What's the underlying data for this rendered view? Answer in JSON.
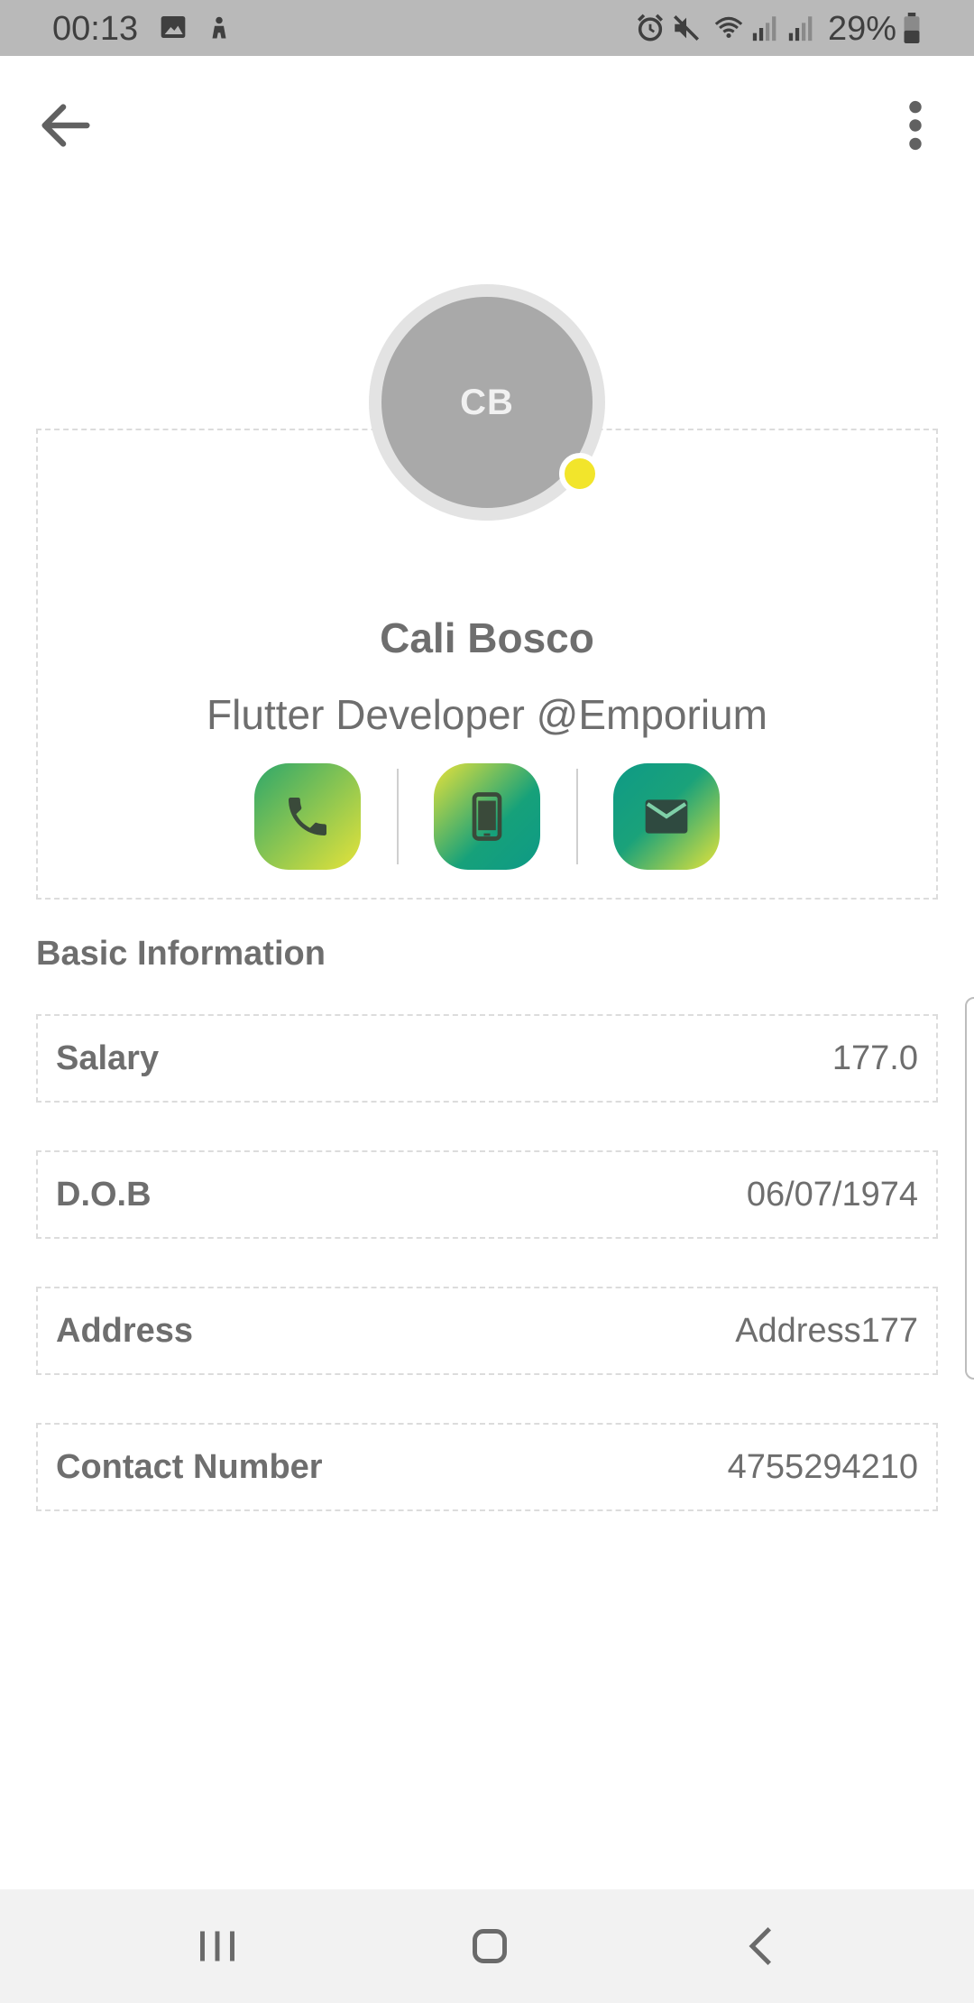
{
  "status_bar": {
    "time": "00:13",
    "battery": "29%",
    "icons": [
      "image-icon",
      "android-debug-icon",
      "alarm-icon",
      "mute-icon",
      "wifi-icon",
      "signal-icon",
      "signal-icon",
      "battery-icon"
    ]
  },
  "app_bar": {
    "back_icon": "arrow-left-icon",
    "menu_icon": "more-vertical-icon"
  },
  "profile": {
    "initials": "CB",
    "name": "Cali Bosco",
    "subtitle": "Flutter Developer @Emporium",
    "status_color": "#f2e52b",
    "actions": [
      {
        "icon": "phone-icon"
      },
      {
        "icon": "smartphone-icon"
      },
      {
        "icon": "email-icon"
      }
    ]
  },
  "basic_info": {
    "title": "Basic Information",
    "rows": [
      {
        "label": "Salary",
        "value": "177.0"
      },
      {
        "label": "D.O.B",
        "value": "06/07/1974"
      },
      {
        "label": "Address",
        "value": "Address177"
      },
      {
        "label": "Contact Number",
        "value": "4755294210"
      }
    ]
  },
  "nav_bar": {
    "icons": [
      "recents-icon",
      "home-icon",
      "back-icon"
    ]
  }
}
